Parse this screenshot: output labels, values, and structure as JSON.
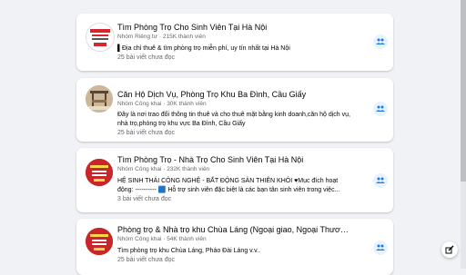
{
  "groups": [
    {
      "title": "Tìm Phòng Trọ Cho Sinh Viên Tại Hà Nội",
      "meta": "Nhóm Riêng tư · 215K thành viên",
      "description": "▌Địa chỉ thuê & tìm phòng trọ miễn phí, uy tín nhất tại Hà Nội",
      "unread": "25 bài viết chưa đọc",
      "thumb_icon": "red-white-logo-icon",
      "colors": {
        "thumb_bg": "#ffffff",
        "thumb_accent": "#d8262c"
      }
    },
    {
      "title": "Căn Hộ Dịch Vụ, Phòng Trọ Khu Ba Đình, Cầu Giấy",
      "meta": "Nhóm Công khai · 30K thành viên",
      "description": "Đây là nơi trao đổi thông tin thuê và cho thuê mặt bằng kinh doanh,căn hộ dịch vụ, nhà trọ,phòng trọ khu vực Ba Đình, Cầu Giấy",
      "unread": "25 bài viết chưa đọc",
      "thumb_icon": "room-photo-icon",
      "colors": {
        "thumb_bg": "#cbb79a",
        "thumb_accent": "#5a4532"
      }
    },
    {
      "title": "Tìm Phòng Trọ - Nhà Trọ Cho Sinh Viên Tại Hà Nội",
      "meta": "Nhóm Công khai · 232K thành viên",
      "description": "HỆ SINH THÁI CÔNG NGHỆ - BẤT ĐỘNG SẢN THIÊN KHÔI ♥Mục đích hoạt động: ---------- 🟦 Hỗ trợ sinh viên đặc biệt là các bạn tân sinh viên trong việc...",
      "unread": "3 bài viết chưa đọc",
      "thumb_icon": "red-logo-icon",
      "colors": {
        "thumb_bg": "#c8262a",
        "thumb_accent": "#ffd54a"
      }
    },
    {
      "title": "Phòng trọ & Nhà trọ khu Chùa Láng (Ngoại giao, Ngoại Thương, Luật,...)",
      "meta": "Nhóm Công khai · 54K thành viên",
      "description": "Tìm phòng trọ khu Chùa Láng, Pháo Đài Láng v.v..",
      "unread": "25 bài viết chưa đọc",
      "thumb_icon": "red-logo-icon",
      "colors": {
        "thumb_bg": "#c8262a",
        "thumb_accent": "#ffd54a"
      }
    }
  ],
  "colors": {
    "accent": "#1877f2",
    "page_bg": "#f0f2f5"
  }
}
